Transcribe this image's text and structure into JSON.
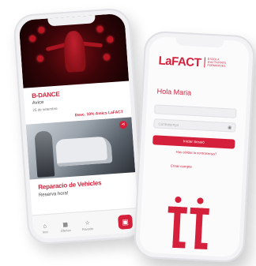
{
  "feed_screen": {
    "event": {
      "title": "B-DANCE",
      "subtitle": "Avice",
      "date": "25 de setembre",
      "discount": "Desc. 10% Amics LaFACT"
    },
    "workshop": {
      "title": "Reparacio de Vehicles",
      "subtitle": "Reserva hora!",
      "share_icon": "⋖"
    },
    "tabs": [
      {
        "icon": "⌂",
        "label": "Inici"
      },
      {
        "icon": "▦",
        "label": "Ofertes"
      },
      {
        "icon": "☆",
        "label": "Favorits"
      }
    ],
    "fab_icon": "▣",
    "colors": {
      "accent": "#d5203b",
      "dark_stage": "#3a0508"
    }
  },
  "login_screen": {
    "logo": "LaFACT",
    "logo_tagline": "ESCOLA D'ACTIVITATS FORMATIVES",
    "greeting": "Hola Maria",
    "email_placeholder": "",
    "password_placeholder": "Contrasenya",
    "password_icon": "◉",
    "login_button": "Iniciar Sessió",
    "forgot_link": "Has oblidat la contrasenya?",
    "create_link": "Crear compte",
    "colors": {
      "accent": "#d5203b",
      "field_bg": "#efeff2"
    }
  }
}
